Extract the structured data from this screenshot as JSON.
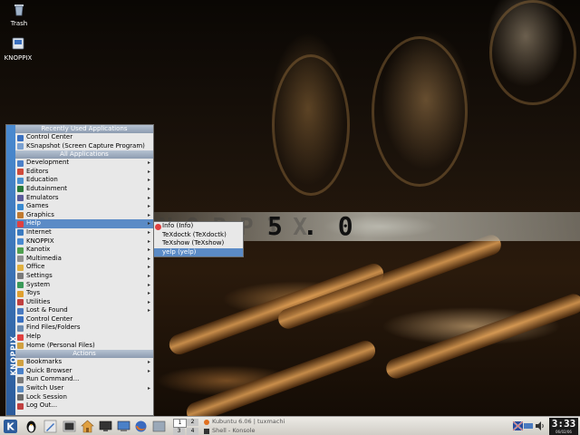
{
  "desktop": {
    "icons": [
      {
        "label": "Trash",
        "icon": "trash-icon"
      },
      {
        "label": "KNOPPIX",
        "icon": "drive-icon"
      }
    ],
    "wallpaper_text": "5.0",
    "wallpaper_ghost_text": "NOPPIX"
  },
  "menu": {
    "side_label": "KNOPPIX",
    "recent_header": "Recently Used Applications",
    "recent": [
      {
        "label": "Control Center",
        "color": "#3a70c0"
      },
      {
        "label": "KSnapshot (Screen Capture Program)",
        "color": "#7aa0d0"
      }
    ],
    "all_header": "All Applications",
    "apps": [
      {
        "label": "Development",
        "color": "#4c80c8",
        "submenu": true
      },
      {
        "label": "Editors",
        "color": "#d04a3a",
        "submenu": true
      },
      {
        "label": "Education",
        "color": "#4a90d0",
        "submenu": true
      },
      {
        "label": "Edutainment",
        "color": "#2a7a3a",
        "submenu": true
      },
      {
        "label": "Emulators",
        "color": "#5a5a9a",
        "submenu": true
      },
      {
        "label": "Games",
        "color": "#3a8ad0",
        "submenu": true
      },
      {
        "label": "Graphics",
        "color": "#c07a30",
        "submenu": true
      },
      {
        "label": "Help",
        "color": "#e04040",
        "submenu": true,
        "selected": true
      },
      {
        "label": "Internet",
        "color": "#3a7ac0",
        "submenu": true
      },
      {
        "label": "KNOPPIX",
        "color": "#4a8ad0",
        "submenu": true
      },
      {
        "label": "Kanotix",
        "color": "#50a050",
        "submenu": true
      },
      {
        "label": "Multimedia",
        "color": "#909090",
        "submenu": true
      },
      {
        "label": "Office",
        "color": "#e0b040",
        "submenu": true
      },
      {
        "label": "Settings",
        "color": "#7a7a7a",
        "submenu": true
      },
      {
        "label": "System",
        "color": "#3a9a5a",
        "submenu": true
      },
      {
        "label": "Toys",
        "color": "#e0a030",
        "submenu": true
      },
      {
        "label": "Utilities",
        "color": "#c04040",
        "submenu": true
      },
      {
        "label": "Lost & Found",
        "color": "#4a7ac0",
        "submenu": true
      },
      {
        "label": "Control Center",
        "color": "#3a70c0",
        "submenu": false
      },
      {
        "label": "Find Files/Folders",
        "color": "#6a8ab0",
        "submenu": false
      },
      {
        "label": "Help",
        "color": "#e04040",
        "submenu": false
      },
      {
        "label": "Home (Personal Files)",
        "color": "#d0a040",
        "submenu": false
      }
    ],
    "actions_header": "Actions",
    "actions": [
      {
        "label": "Bookmarks",
        "color": "#d0a040",
        "submenu": true
      },
      {
        "label": "Quick Browser",
        "color": "#4a80c8",
        "submenu": true
      },
      {
        "label": "Run Command...",
        "color": "#7a7a7a",
        "submenu": false
      },
      {
        "label": "Switch User",
        "color": "#5a8ac0",
        "submenu": true
      },
      {
        "label": "Lock Session",
        "color": "#6a6a6a",
        "submenu": false
      },
      {
        "label": "Log Out...",
        "color": "#c04040",
        "submenu": false
      }
    ]
  },
  "help_submenu": [
    {
      "label": "Info (Info)",
      "color": "#e04040",
      "selected": false
    },
    {
      "label": "TeXdoctk (TeXdoctk)",
      "color": "",
      "selected": false
    },
    {
      "label": "TeXshow (TeXshow)",
      "color": "",
      "selected": false
    },
    {
      "label": "yelp (yelp)",
      "color": "",
      "selected": true
    }
  ],
  "taskbar": {
    "pager": [
      "1",
      "2",
      "3",
      "4"
    ],
    "tasks": [
      "Kubuntu 6.06 | tuxmachi",
      "Shell - Konsole"
    ],
    "clock_time": "3:33",
    "clock_date": "06/02/06"
  }
}
